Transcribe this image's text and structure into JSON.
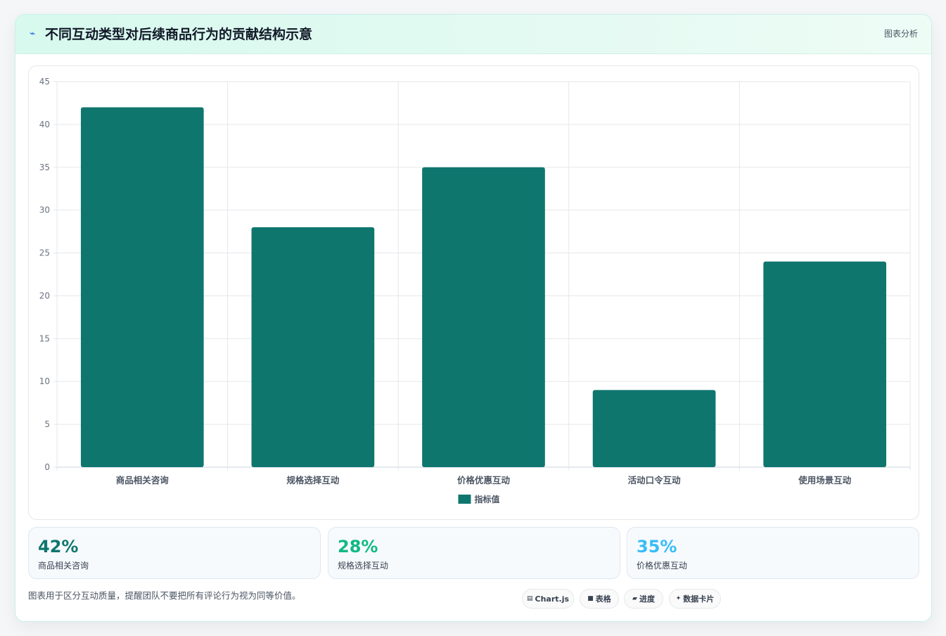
{
  "header": {
    "icon": "chart-line-icon",
    "title": "不同互动类型对后续商品行为的贡献结构示意",
    "tag": "图表分析"
  },
  "colors": {
    "bar": "#0f766e",
    "stat1": "#0f766e",
    "stat2": "#10b981",
    "stat3": "#38bdf8",
    "grid": "#e5e7eb",
    "axis_text": "#6b7280"
  },
  "chart_data": {
    "type": "bar",
    "categories": [
      "商品相关咨询",
      "规格选择互动",
      "价格优惠互动",
      "活动口令互动",
      "使用场景互动"
    ],
    "series": [
      {
        "name": "指标值",
        "values": [
          42,
          28,
          35,
          9,
          24
        ]
      }
    ],
    "ylim": [
      0,
      45
    ],
    "yticks": [
      0,
      5,
      10,
      15,
      20,
      25,
      30,
      35,
      40,
      45
    ],
    "grid": true,
    "legend": "bottom-center"
  },
  "stats": [
    {
      "value": "42%",
      "label": "商品相关咨询"
    },
    {
      "value": "28%",
      "label": "规格选择互动"
    },
    {
      "value": "35%",
      "label": "价格优惠互动"
    }
  ],
  "footnote": "图表用于区分互动质量，提醒团队不要把所有评论行为视为同等价值。",
  "pills": [
    {
      "icon": "chart-icon",
      "glyph": "▤",
      "label": "Chart.js"
    },
    {
      "icon": "table-icon",
      "glyph": "■",
      "label": "表格"
    },
    {
      "icon": "progress-icon",
      "glyph": "▰",
      "label": "进度"
    },
    {
      "icon": "sparkle-icon",
      "glyph": "✦",
      "label": "数据卡片"
    }
  ]
}
